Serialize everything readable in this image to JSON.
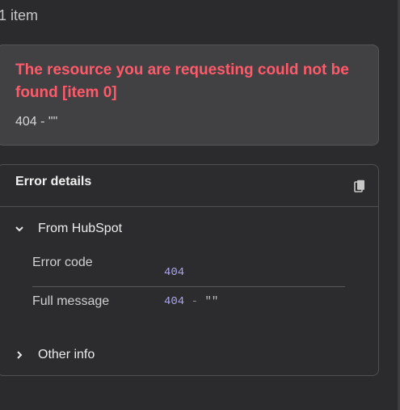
{
  "header": {
    "item_count": "1 item"
  },
  "error": {
    "title": "The resource you are requesting could not be found [item 0]",
    "subtitle": "404 - \"\""
  },
  "details": {
    "title": "Error details",
    "copy_icon": "copy-icon",
    "from_section": {
      "label": "From HubSpot",
      "expanded": true,
      "fields": [
        {
          "label": "Error code",
          "value": "404"
        },
        {
          "label": "Full message",
          "value_num": "404",
          "value_sep": "-",
          "value_str": "\"\""
        }
      ]
    },
    "other_section": {
      "label": "Other info",
      "expanded": false
    }
  },
  "colors": {
    "error_title": "#ff5a6a",
    "mono_number": "#a9a5ea",
    "background": "#2b2b2d"
  }
}
